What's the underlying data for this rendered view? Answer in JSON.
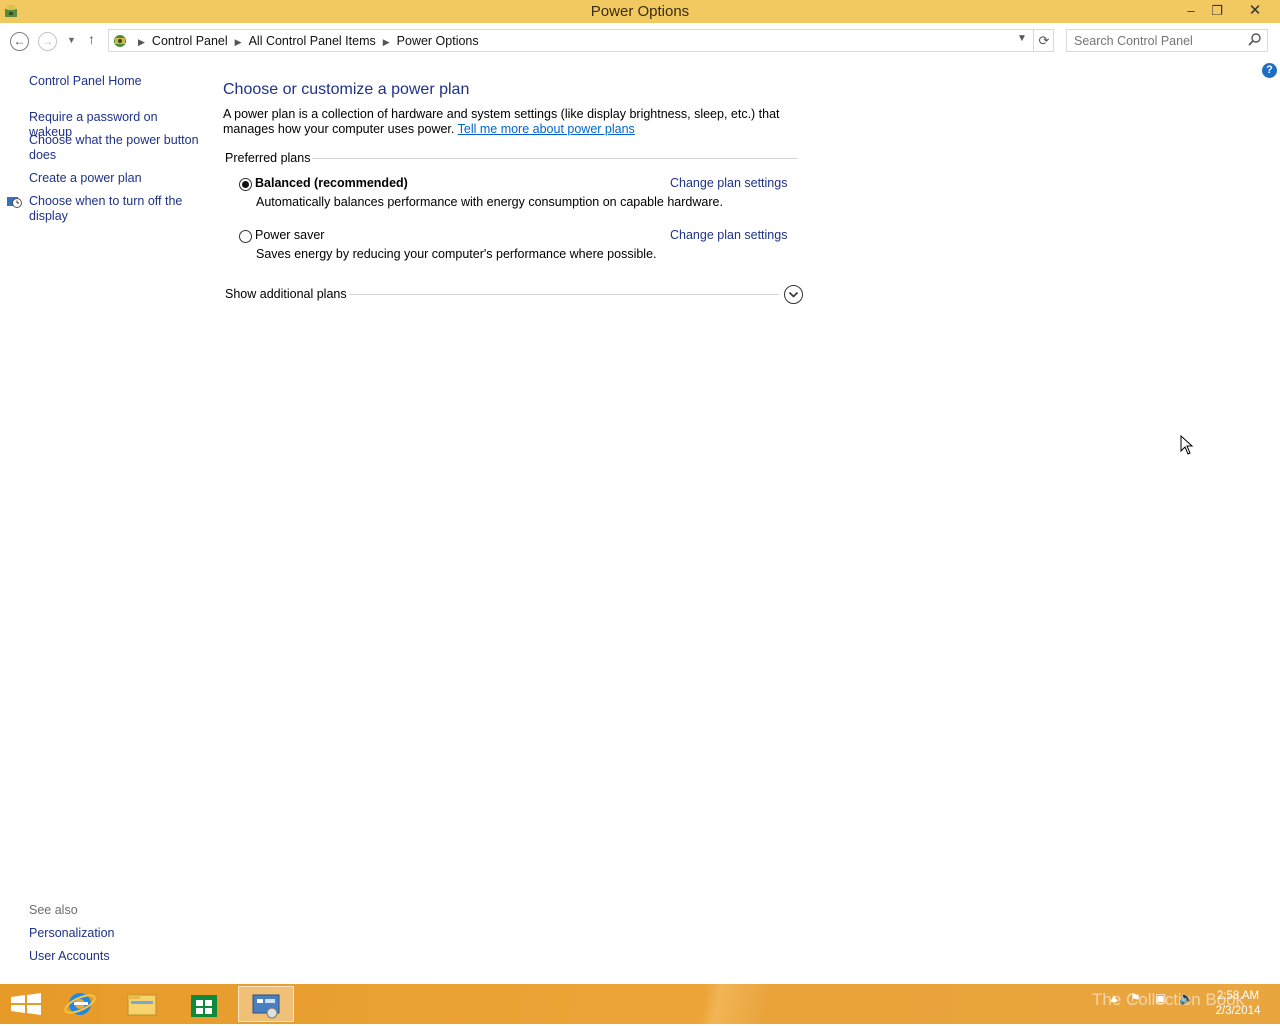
{
  "window": {
    "title": "Power Options",
    "minimize": "–",
    "maximize": "❐",
    "close": "✕"
  },
  "address": {
    "crumbs": [
      "Control Panel",
      "All Control Panel Items",
      "Power Options"
    ],
    "search_placeholder": "Search Control Panel"
  },
  "help_label": "?",
  "sidebar": {
    "home": "Control Panel Home",
    "items": [
      "Require a password on wakeup",
      "Choose what the power button does",
      "Create a power plan",
      "Choose when to turn off the display"
    ],
    "see_also_label": "See also",
    "see_also": [
      "Personalization",
      "User Accounts"
    ]
  },
  "main": {
    "heading": "Choose or customize a power plan",
    "description": "A power plan is a collection of hardware and system settings (like display brightness, sleep, etc.) that manages how your computer uses power.",
    "learn_more": "Tell me more about power plans",
    "preferred_label": "Preferred plans",
    "plans": [
      {
        "name": "Balanced (recommended)",
        "description": "Automatically balances performance with energy consumption on capable hardware.",
        "selected": true,
        "change": "Change plan settings"
      },
      {
        "name": "Power saver",
        "description": "Saves energy by reducing your computer's performance where possible.",
        "selected": false,
        "change": "Change plan settings"
      }
    ],
    "additional_label": "Show additional plans"
  },
  "taskbar": {
    "time": "2:58 AM",
    "date": "2/3/2014",
    "watermark": "The Collection Book"
  }
}
